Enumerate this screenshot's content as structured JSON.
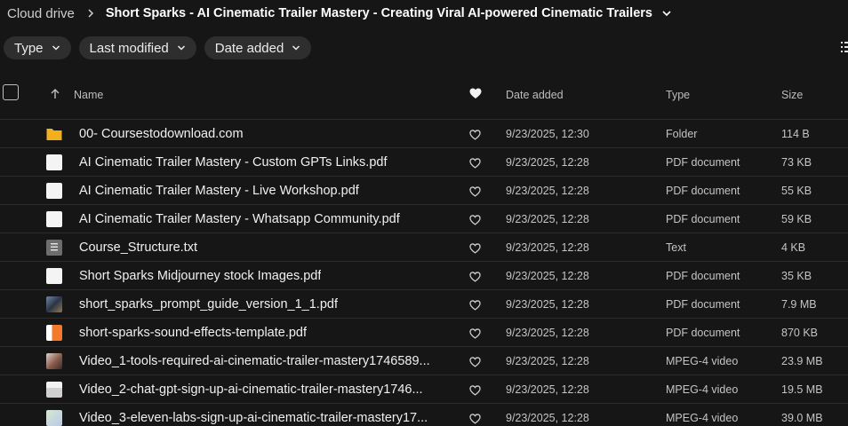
{
  "breadcrumb": {
    "root": "Cloud drive",
    "current": "Short Sparks - AI Cinematic Trailer Mastery - Creating Viral AI-powered Cinematic Trailers"
  },
  "filters": [
    {
      "label": "Type"
    },
    {
      "label": "Last modified"
    },
    {
      "label": "Date added"
    }
  ],
  "columns": {
    "name": "Name",
    "date_added": "Date added",
    "type": "Type",
    "size": "Size"
  },
  "files": [
    {
      "icon": "folder-icon",
      "name": "00- Coursestodownload.com",
      "date": "9/23/2025, 12:30",
      "type": "Folder",
      "size": "114 B"
    },
    {
      "icon": "pdf-file-icon",
      "name": "AI Cinematic Trailer Mastery - Custom GPTs Links.pdf",
      "date": "9/23/2025, 12:28",
      "type": "PDF document",
      "size": "73 KB"
    },
    {
      "icon": "pdf-file-icon",
      "name": "AI Cinematic Trailer Mastery - Live Workshop.pdf",
      "date": "9/23/2025, 12:28",
      "type": "PDF document",
      "size": "55 KB"
    },
    {
      "icon": "pdf-file-icon",
      "name": "AI Cinematic Trailer Mastery - Whatsapp Community.pdf",
      "date": "9/23/2025, 12:28",
      "type": "PDF document",
      "size": "59 KB"
    },
    {
      "icon": "text-file-icon",
      "name": "Course_Structure.txt",
      "date": "9/23/2025, 12:28",
      "type": "Text",
      "size": "4 KB"
    },
    {
      "icon": "pdf-file-icon",
      "name": "Short Sparks Midjourney stock Images.pdf",
      "date": "9/23/2025, 12:28",
      "type": "PDF document",
      "size": "35 KB"
    },
    {
      "icon": "pdf-thumbnail-icon",
      "name": "short_sparks_prompt_guide_version_1_1.pdf",
      "date": "9/23/2025, 12:28",
      "type": "PDF document",
      "size": "7.9 MB"
    },
    {
      "icon": "pdf-thumbnail-icon",
      "name": "short-sparks-sound-effects-template.pdf",
      "date": "9/23/2025, 12:28",
      "type": "PDF document",
      "size": "870 KB"
    },
    {
      "icon": "video-thumbnail-icon",
      "name": "Video_1-tools-required-ai-cinematic-trailer-mastery1746589...",
      "date": "9/23/2025, 12:28",
      "type": "MPEG-4 video",
      "size": "23.9 MB"
    },
    {
      "icon": "video-thumbnail-icon",
      "name": "Video_2-chat-gpt-sign-up-ai-cinematic-trailer-mastery1746...",
      "date": "9/23/2025, 12:28",
      "type": "MPEG-4 video",
      "size": "19.5 MB"
    },
    {
      "icon": "video-thumbnail-icon",
      "name": "Video_3-eleven-labs-sign-up-ai-cinematic-trailer-mastery17...",
      "date": "9/23/2025, 12:28",
      "type": "MPEG-4 video",
      "size": "39.0 MB"
    }
  ],
  "colors": {
    "background": "#161616",
    "chip": "#2e2e2e",
    "folder": "#f2b01e"
  }
}
